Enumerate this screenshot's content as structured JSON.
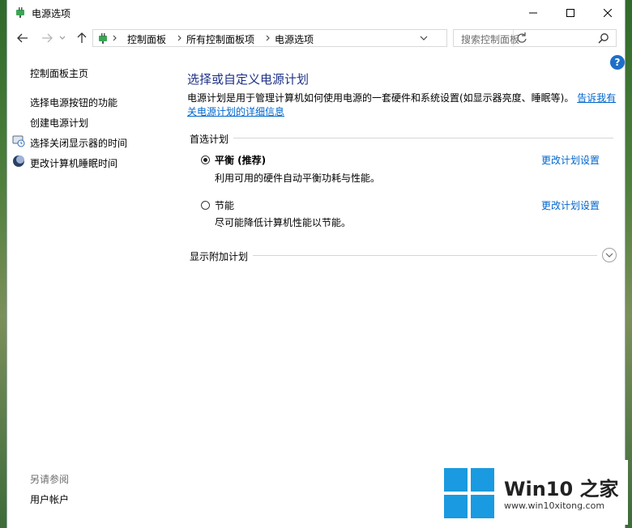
{
  "window": {
    "title": "电源选项"
  },
  "address": {
    "crumbs": [
      "控制面板",
      "所有控制面板项",
      "电源选项"
    ]
  },
  "search": {
    "placeholder": "搜索控制面板"
  },
  "help": {
    "label": "?"
  },
  "sidebar": {
    "home": "控制面板主页",
    "items": [
      {
        "label": "选择电源按钮的功能",
        "icon": "none"
      },
      {
        "label": "创建电源计划",
        "icon": "none"
      },
      {
        "label": "选择关闭显示器的时间",
        "icon": "monitor-clock-icon"
      },
      {
        "label": "更改计算机睡眠时间",
        "icon": "moon-icon"
      }
    ],
    "see_also": "另请参阅",
    "see_also_items": [
      "用户帐户"
    ]
  },
  "main": {
    "heading": "选择或自定义电源计划",
    "desc_text": "电源计划是用于管理计算机如何使用电源的一套硬件和系统设置(如显示器亮度、睡眠等)。",
    "desc_link": "告诉我有关电源计划的详细信息",
    "preferred_label": "首选计划",
    "plans": [
      {
        "name": "平衡 (推荐)",
        "description": "利用可用的硬件自动平衡功耗与性能。",
        "selected": true,
        "change_link": "更改计划设置"
      },
      {
        "name": "节能",
        "description": "尽可能降低计算机性能以节能。",
        "selected": false,
        "change_link": "更改计划设置"
      }
    ],
    "show_more_label": "显示附加计划"
  },
  "watermark": {
    "title": "Win10 之家",
    "url": "www.win10xitong.com"
  },
  "colors": {
    "link": "#0066cc",
    "heading": "#1e3287",
    "help": "#1e6ec8"
  }
}
